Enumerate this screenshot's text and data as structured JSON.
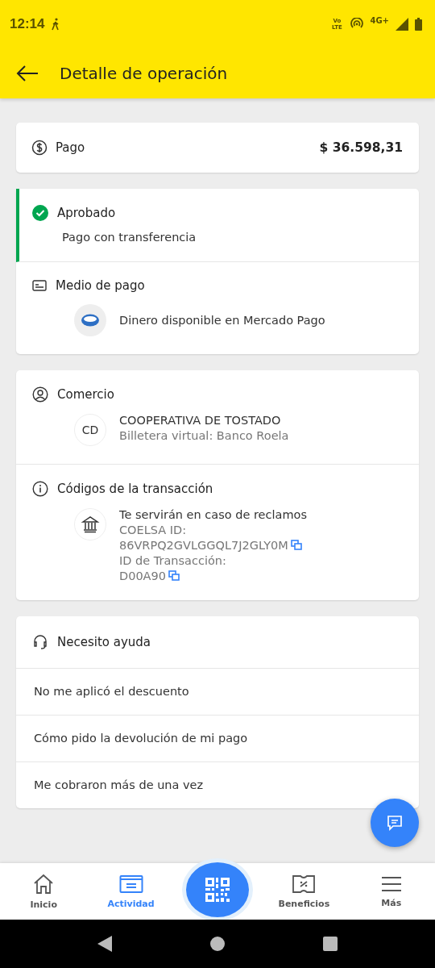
{
  "status_bar": {
    "time": "12:14",
    "network": "4G+",
    "volte": "Vo LTE"
  },
  "app_bar": {
    "title": "Detalle de operación"
  },
  "payment": {
    "label": "Pago",
    "amount": "$ 36.598,31"
  },
  "status": {
    "title": "Aprobado",
    "subtitle": "Pago con transferencia",
    "color": "#00a650"
  },
  "payment_method": {
    "title": "Medio de pago",
    "text": "Dinero disponible en Mercado Pago"
  },
  "merchant": {
    "title": "Comercio",
    "initials": "CD",
    "name": "COOPERATIVA DE TOSTADO",
    "subtitle": "Billetera virtual: Banco Roela"
  },
  "codes": {
    "title": "Códigos de la transacción",
    "intro": "Te servirán en caso de reclamos",
    "items": [
      {
        "label": "COELSA ID:",
        "value": "86VRPQ2GVLGGQL7J2GLY0M"
      },
      {
        "label": "ID de Transacción:",
        "value": "D00A90"
      }
    ]
  },
  "help": {
    "title": "Necesito ayuda",
    "items": [
      "No me aplicó el descuento",
      "Cómo pido la devolución de mi pago",
      "Me cobraron más de una vez"
    ]
  },
  "bottom_nav": [
    {
      "kind": "home",
      "label": "Inicio",
      "selected": false
    },
    {
      "kind": "activity",
      "label": "Actividad",
      "selected": true
    },
    {
      "kind": "qr",
      "selected": false
    },
    {
      "kind": "benefits",
      "label": "Beneficios",
      "selected": false
    },
    {
      "kind": "more",
      "label": "Más",
      "selected": false
    }
  ]
}
